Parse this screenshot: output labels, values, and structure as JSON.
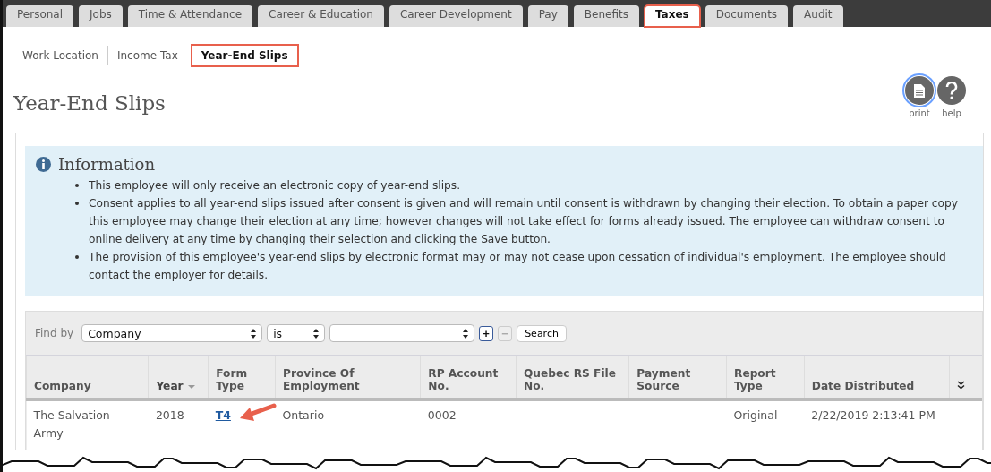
{
  "tabs": [
    {
      "label": "Personal",
      "selected": false
    },
    {
      "label": "Jobs",
      "selected": false
    },
    {
      "label": "Time & Attendance",
      "selected": false
    },
    {
      "label": "Career & Education",
      "selected": false
    },
    {
      "label": "Career Development",
      "selected": false
    },
    {
      "label": "Pay",
      "selected": false
    },
    {
      "label": "Benefits",
      "selected": false
    },
    {
      "label": "Taxes",
      "selected": true
    },
    {
      "label": "Documents",
      "selected": false
    },
    {
      "label": "Audit",
      "selected": false
    }
  ],
  "subtabs": [
    {
      "label": "Work Location",
      "selected": false
    },
    {
      "label": "Income Tax",
      "selected": false
    },
    {
      "label": "Year-End Slips",
      "selected": true
    }
  ],
  "page_title": "Year-End Slips",
  "actions": [
    {
      "kind": "print",
      "label": "print",
      "focused": true
    },
    {
      "kind": "help",
      "label": "help",
      "focused": false
    }
  ],
  "info": {
    "title": "Information",
    "items": [
      "This employee will only receive an electronic copy of year-end slips.",
      "Consent applies to all year-end slips issued after consent is given and will remain until consent is withdrawn by changing their election. To obtain a paper copy this employee may change their election at any time; however changes will not take effect for forms already issued. The employee can withdraw consent to online delivery at any time by changing their selection and clicking the Save button.",
      "The provision of this employee's year-end slips by electronic format may or may not cease upon cessation of individual's employment. The employee should contact the employer for details."
    ]
  },
  "filter": {
    "label": "Find by",
    "field": "Company",
    "operator": "is",
    "add": {
      "label": "+",
      "disabled": false
    },
    "remove": {
      "label": "−",
      "disabled": true
    },
    "search": "Search"
  },
  "table": {
    "columns": [
      {
        "label": "Company",
        "sorted": false
      },
      {
        "label": "Year",
        "sorted": true
      },
      {
        "label": "Form Type",
        "sorted": false
      },
      {
        "label": "Province Of Employment",
        "sorted": false
      },
      {
        "label": "RP Account No.",
        "sorted": false
      },
      {
        "label": "Quebec RS File No.",
        "sorted": false
      },
      {
        "label": "Payment Source",
        "sorted": false
      },
      {
        "label": "Report Type",
        "sorted": false
      },
      {
        "label": "Date Distributed",
        "sorted": false
      }
    ],
    "rows": [
      [
        {
          "text": "The Salvation Army",
          "kind": "text"
        },
        {
          "text": "2018",
          "kind": "text"
        },
        {
          "text": "T4",
          "kind": "link"
        },
        {
          "text": "Ontario",
          "kind": "text"
        },
        {
          "text": "0002",
          "kind": "text"
        },
        {
          "text": "",
          "kind": "text"
        },
        {
          "text": "",
          "kind": "text"
        },
        {
          "text": "Original",
          "kind": "text"
        },
        {
          "text": "2/22/2019 2:13:41 PM",
          "kind": "text"
        }
      ]
    ]
  }
}
